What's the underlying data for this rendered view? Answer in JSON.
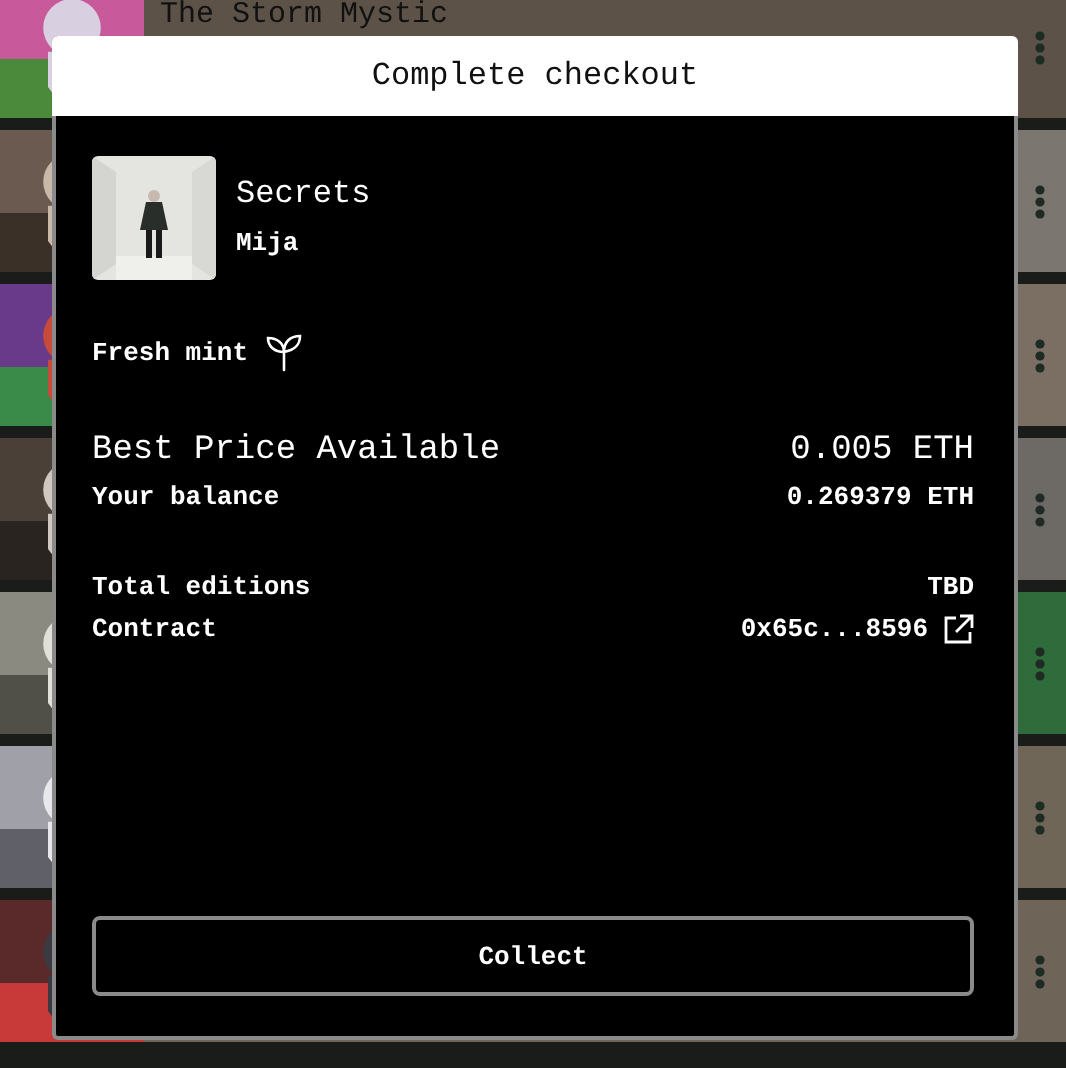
{
  "background_list": {
    "rows": [
      {
        "kind": "picture",
        "title": "The Storm Mystic"
      },
      {
        "kind": "picture"
      },
      {
        "kind": "picture"
      },
      {
        "kind": "picture"
      },
      {
        "kind": "picture"
      },
      {
        "kind": "picture"
      },
      {
        "kind": "picture"
      }
    ]
  },
  "dialog": {
    "title": "Complete checkout",
    "item": {
      "thumbnail": {
        "kind": "picture"
      },
      "name": "Secrets",
      "artist": "Mija"
    },
    "badge": "Fresh mint",
    "price": {
      "label": "Best Price Available",
      "value": "0.005 ETH"
    },
    "balance": {
      "label": "Your balance",
      "value": "0.269379 ETH"
    },
    "details": [
      {
        "kind": "text",
        "label": "Total editions",
        "value": "TBD"
      },
      {
        "kind": "link",
        "label": "Contract",
        "value": "0x65c...8596"
      }
    ],
    "button": "Collect"
  }
}
